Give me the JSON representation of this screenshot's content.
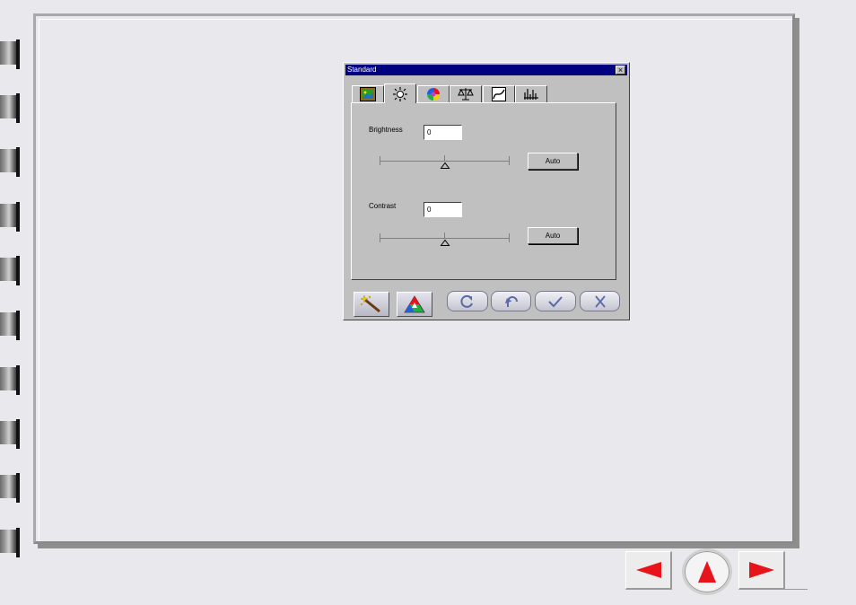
{
  "dialog": {
    "title": "Standard",
    "close_glyph": "×",
    "tabs": [
      {
        "icon": "image-icon",
        "active": false
      },
      {
        "icon": "brightness-icon",
        "active": true
      },
      {
        "icon": "color-wheel-icon",
        "active": false
      },
      {
        "icon": "balance-icon",
        "active": false
      },
      {
        "icon": "curve-icon",
        "active": false
      },
      {
        "icon": "histogram-icon",
        "active": false
      }
    ],
    "brightness": {
      "label": "Brightness",
      "value": "0",
      "slider_level": 0.5,
      "auto_label": "Auto"
    },
    "contrast": {
      "label": "Contrast",
      "value": "0",
      "slider_level": 0.5,
      "auto_label": "Auto"
    },
    "toolbar": [
      {
        "icon": "magic-wand-icon"
      },
      {
        "icon": "rgb-triangle-icon"
      },
      {
        "icon": "refresh-icon"
      },
      {
        "icon": "undo-icon"
      },
      {
        "icon": "checkmark-icon"
      },
      {
        "icon": "cancel-x-icon"
      }
    ]
  },
  "navigation": {
    "prev_icon": "left-arrow-icon",
    "home_icon": "up-arrow-icon",
    "next_icon": "right-arrow-icon",
    "arrow_color": "#e8141c"
  }
}
